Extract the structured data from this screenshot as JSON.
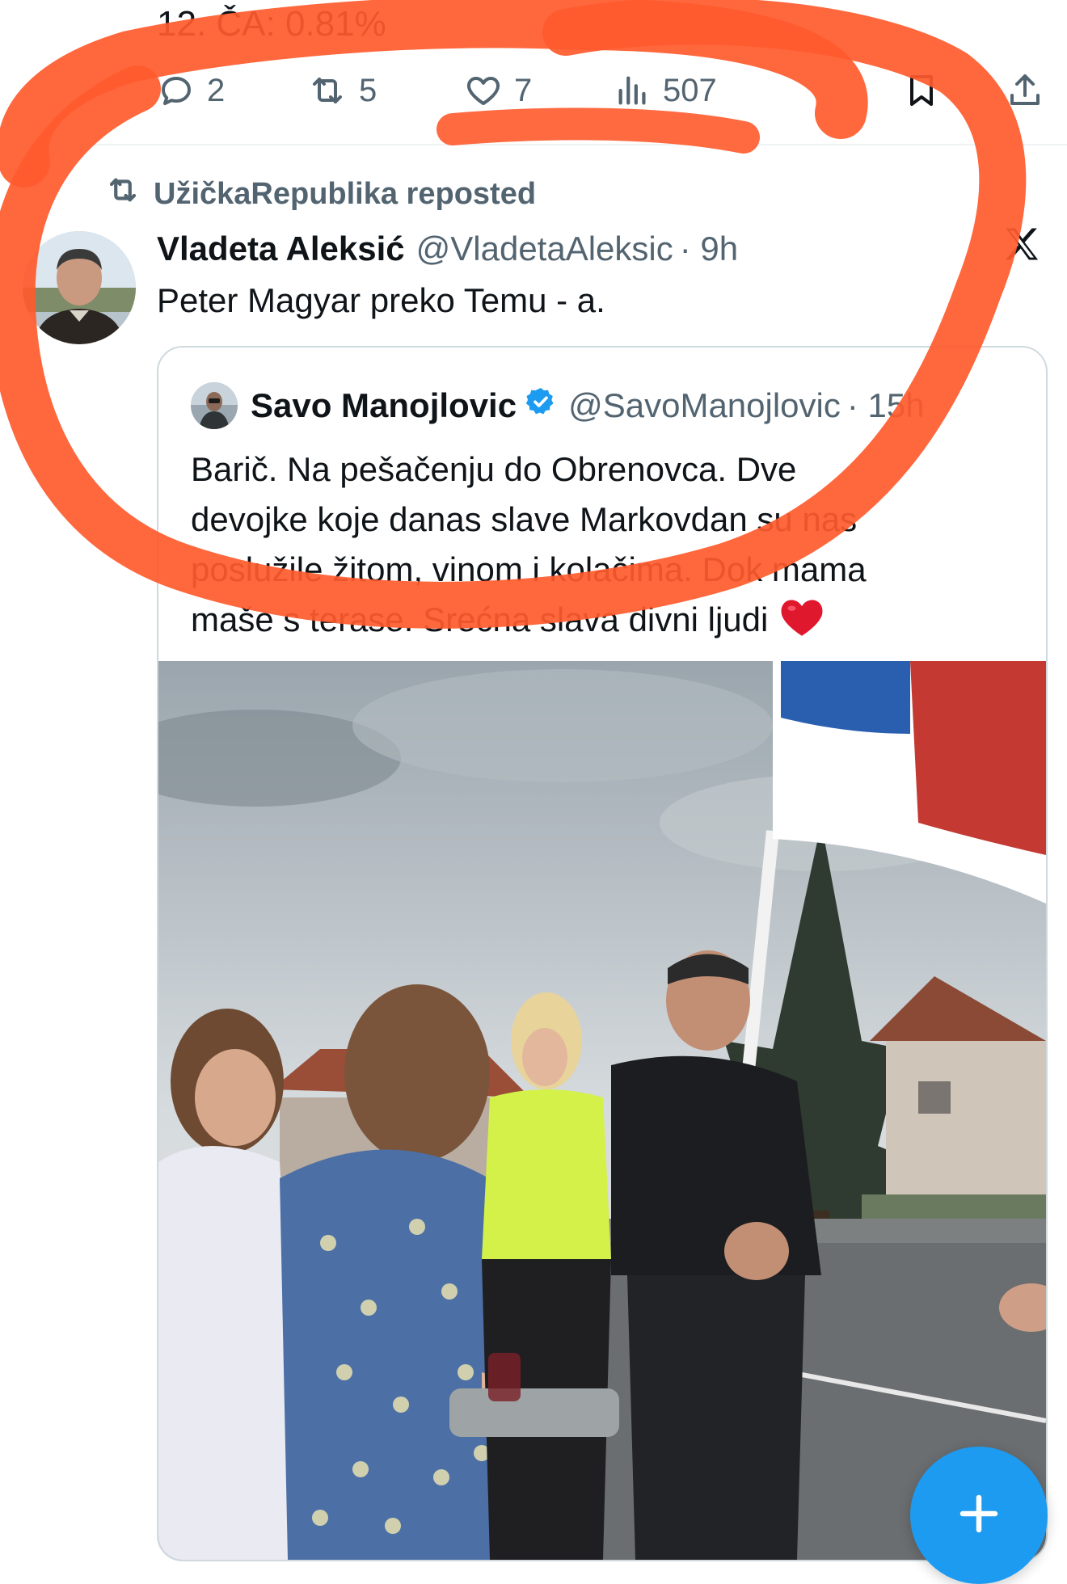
{
  "previous_tweet": {
    "text_line": "12. ČA: 0.81%",
    "actions": {
      "replies": "2",
      "reposts": "5",
      "likes": "7",
      "views": "507"
    }
  },
  "repost_line": {
    "icon": "repost-icon",
    "text": "UžičkaRepublika reposted"
  },
  "tweet": {
    "author_name": "Vladeta Aleksić",
    "author_handle": "@VladetaAleksic",
    "time": "· 9h",
    "text": "Peter Magyar preko Temu - a.",
    "platform_icon": "x-logo-icon"
  },
  "quoted_tweet": {
    "author_name": "Savo Manojlovic",
    "verified": true,
    "author_handle": "@SavoManojlovic",
    "time": "· 15h",
    "text_lines": [
      "Barič. Na pešačenju do Obrenovca. Dve",
      "devojke koje danas slave Markovdan su nas",
      "poslužile žitom, vinom i kolačima. Dok mama",
      "maše s terase. Srećna slava divni ljudi"
    ],
    "emoji": "red-heart-icon",
    "media_type": "video"
  },
  "fab": {
    "icon": "plus-icon"
  },
  "colors": {
    "text_primary": "#0f1419",
    "text_secondary": "#536471",
    "accent_blue": "#1d9bf0",
    "annotation_red": "#ff5a2c",
    "border": "#cfd9de"
  }
}
